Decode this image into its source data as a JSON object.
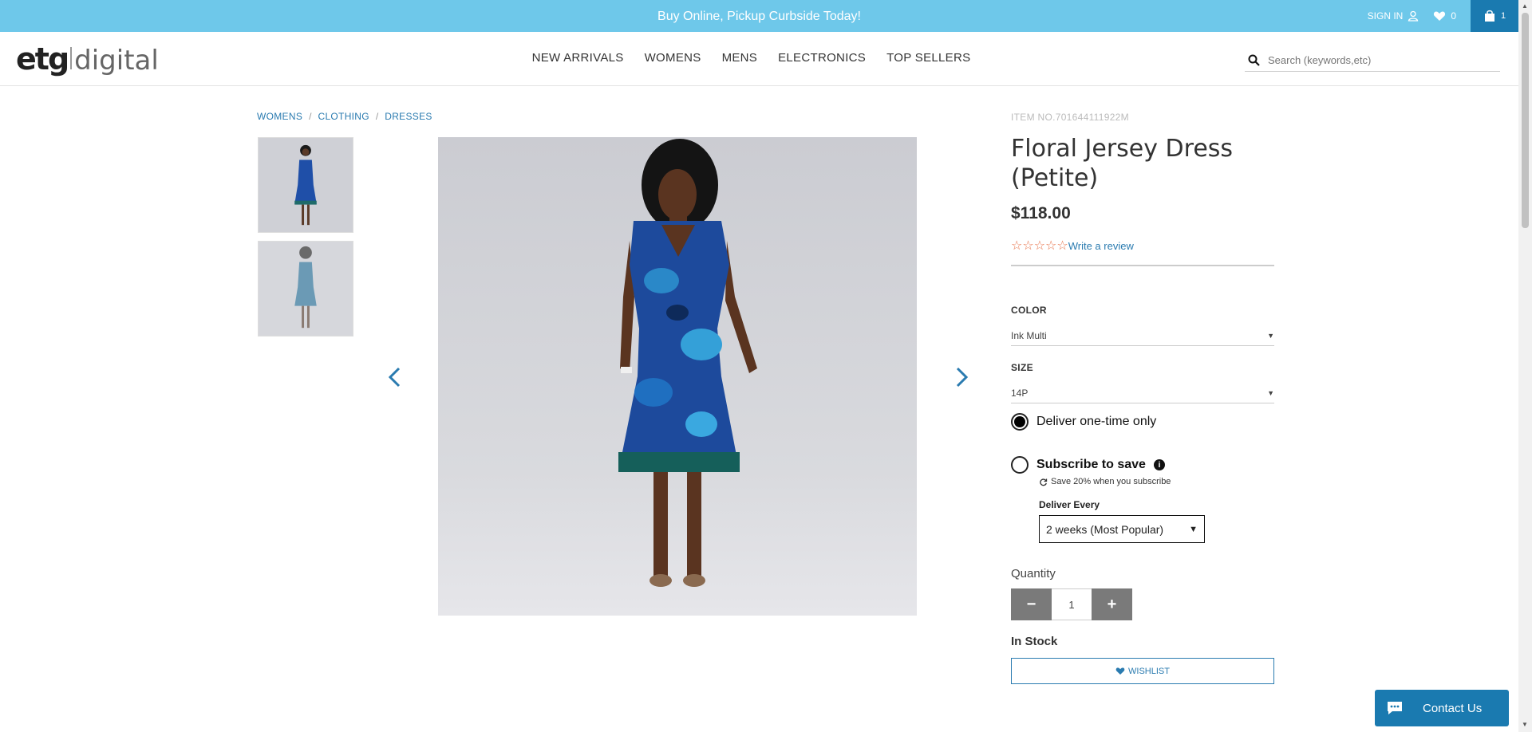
{
  "promo": {
    "text": "Buy Online, Pickup Curbside Today!"
  },
  "utility": {
    "sign_in": "SIGN IN",
    "wishlist_count": "0",
    "cart_count": "1"
  },
  "logo": {
    "part1": "etg",
    "part2": "digital"
  },
  "nav": [
    "NEW ARRIVALS",
    "WOMENS",
    "MENS",
    "ELECTRONICS",
    "TOP SELLERS"
  ],
  "search": {
    "placeholder": "Search (keywords,etc)"
  },
  "breadcrumb": [
    "WOMENS",
    "CLOTHING",
    "DRESSES"
  ],
  "product": {
    "item_no": "ITEM NO.701644111922M",
    "title_line1": "Floral Jersey Dress",
    "title_line2": "(Petite)",
    "price": "$118.00",
    "stars": "☆☆☆☆☆",
    "rating": 0,
    "write_review": "Write a review",
    "color_label": "COLOR",
    "color_value": "Ink Multi",
    "size_label": "SIZE",
    "size_value": "14P",
    "deliver_once": "Deliver one-time only",
    "subscribe": "Subscribe to save",
    "save_note": "Save 20% when you subscribe",
    "deliver_every_label": "Deliver Every",
    "deliver_every_value": "2 weeks (Most Popular)",
    "quantity_label": "Quantity",
    "quantity_value": "1",
    "minus": "−",
    "plus": "+",
    "stock": "In Stock",
    "wishlist_button": "WISHLIST"
  },
  "contact": {
    "label": "Contact Us"
  },
  "colors": {
    "accent": "#2a7bb0",
    "promo_bar": "#6ec8ea",
    "cart": "#1a7ab0",
    "stars": "#e8734a"
  }
}
